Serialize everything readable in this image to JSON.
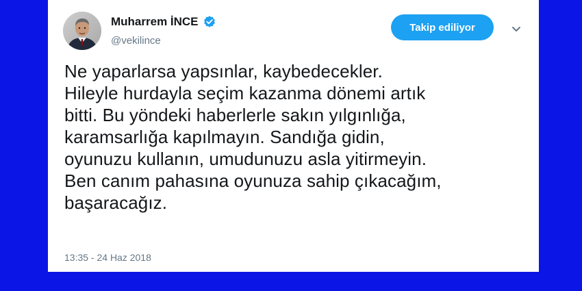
{
  "tweet": {
    "author": {
      "display_name": "Muharrem İNCE",
      "handle": "@vekilince",
      "avatar_icon": "profile-photo",
      "verified": true,
      "verified_icon": "verified-badge-icon"
    },
    "follow_button": {
      "label": "Takip ediliyor"
    },
    "menu_icon": "chevron-down-icon",
    "text_lines": [
      "Ne yaparlarsa yapsınlar, kaybedecekler.",
      "Hileyle hurdayla seçim kazanma dönemi artık",
      "bitti. Bu yöndeki haberlerle sakın yılgınlığa,",
      "karamsarlığa kapılmayın. Sandığa gidin,",
      "oyunuzu kullanın, umudunuzu asla yitirmeyin.",
      "Ben canım pahasına oyunuza sahip çıkacağım,",
      "başaracağız."
    ],
    "timestamp": "13:35 - 24 Haz 2018"
  },
  "colors": {
    "background": "#0b16e6",
    "card": "#ffffff",
    "accent": "#1da1f2",
    "text_primary": "#14171a",
    "text_secondary": "#657786"
  }
}
